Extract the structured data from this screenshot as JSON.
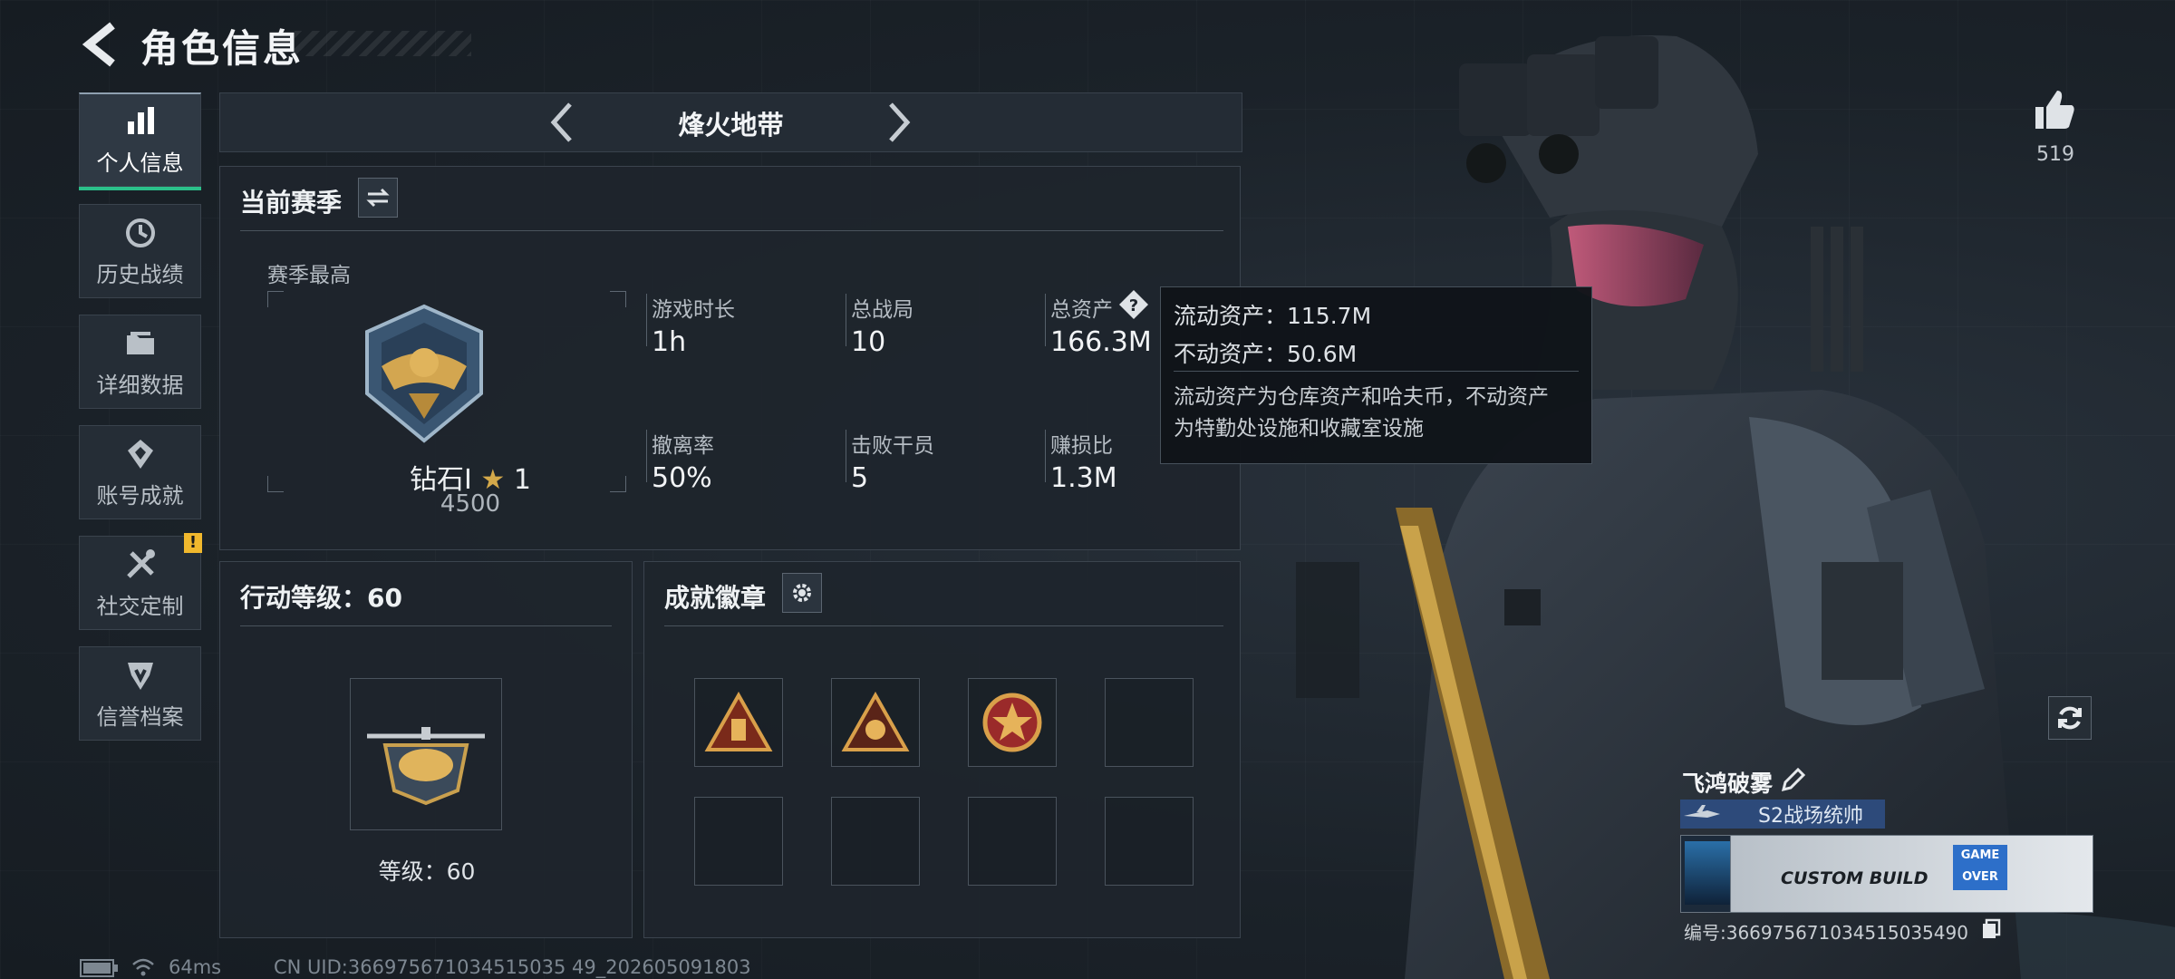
{
  "header": {
    "title": "角色信息"
  },
  "sidebar": {
    "items": [
      {
        "label": "个人信息",
        "icon": "bar-chart-icon"
      },
      {
        "label": "历史战绩",
        "icon": "history-icon"
      },
      {
        "label": "详细数据",
        "icon": "folder-icon"
      },
      {
        "label": "账号成就",
        "icon": "achievement-icon"
      },
      {
        "label": "社交定制",
        "icon": "tools-icon",
        "badge": "!"
      },
      {
        "label": "信誉档案",
        "icon": "credit-icon"
      }
    ]
  },
  "mode_selector": {
    "current": "烽火地带"
  },
  "season": {
    "title": "当前赛季",
    "best_label": "赛季最高",
    "rank_name": "钻石Ⅰ",
    "rank_stars": "1",
    "rank_score": "4500",
    "stats": [
      {
        "label": "游戏时长",
        "value": "1h"
      },
      {
        "label": "总战局",
        "value": "10"
      },
      {
        "label": "总资产",
        "value": "166.3M"
      },
      {
        "label": "撤离率",
        "value": "50%"
      },
      {
        "label": "击败干员",
        "value": "5"
      },
      {
        "label": "赚损比",
        "value": "1.3M"
      }
    ]
  },
  "tooltip": {
    "liquid": "流动资产：115.7M",
    "fixed": "不动资产：50.6M",
    "desc_line1": "流动资产为仓库资产和哈夫币，不动资产",
    "desc_line2": "为特勤处设施和收藏室设施"
  },
  "action_level": {
    "title": "行动等级：60",
    "level_text": "等级：60"
  },
  "badges": {
    "title": "成就徽章",
    "slots": [
      "triangle-badge-icon",
      "triangle-emblem-icon",
      "star-medal-icon",
      "",
      "",
      "",
      "",
      ""
    ]
  },
  "likes": {
    "count": "519"
  },
  "player": {
    "name": "飞鸿破雾",
    "title": "S2战场统帅",
    "card_text": "CUSTOM BUILD",
    "card_game_over": "GAME OVER",
    "id_text": "编号:366975671034515035490"
  },
  "status_bar": {
    "ping": "64ms",
    "uid": "CN UID:366975671034515035 49_202605091803"
  },
  "colors": {
    "accent": "#2bc08a",
    "warning": "#f1b82d",
    "panel": "#1e252d",
    "title_bar": "#2d4a7a"
  }
}
